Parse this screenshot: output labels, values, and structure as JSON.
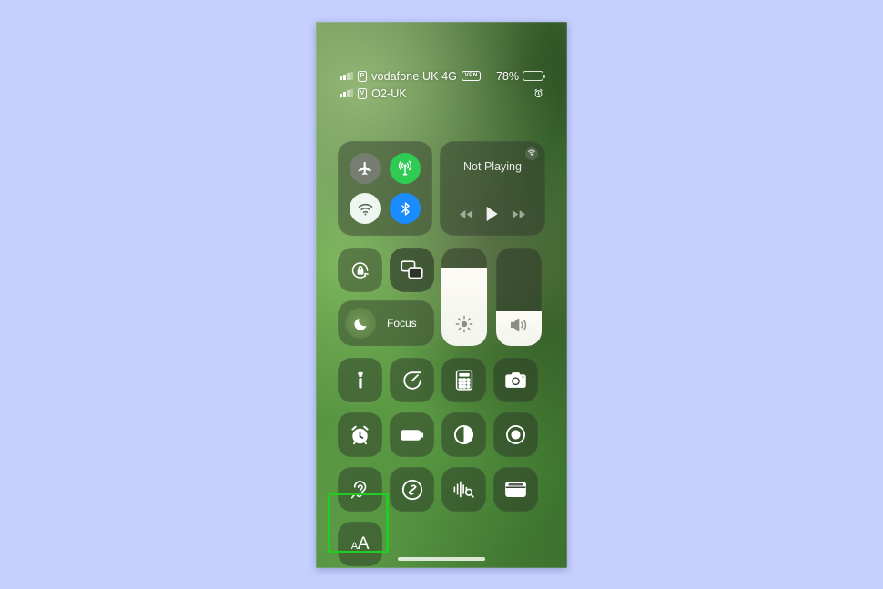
{
  "device": {
    "platform": "iOS",
    "screen_name": "Control Center"
  },
  "status_bar": {
    "line1": {
      "carrier": "vodafone UK 4G",
      "sim_badge": "P",
      "vpn_badge": "VPN",
      "battery_percent": "78%",
      "battery_level": 78
    },
    "line2": {
      "carrier": "O2-UK",
      "sim_badge": "V",
      "alarm_icon": "alarm-clock-icon"
    }
  },
  "connectivity": {
    "airplane": {
      "label": "Airplane Mode",
      "icon": "airplane-icon",
      "state": "off",
      "color": "#7d807c"
    },
    "cellular": {
      "label": "Cellular Data",
      "icon": "cellular-antenna-icon",
      "state": "on",
      "color": "#2fcb52"
    },
    "wifi": {
      "label": "Wi-Fi",
      "icon": "wifi-icon",
      "state": "on",
      "color": "#eef6f0"
    },
    "bluetooth": {
      "label": "Bluetooth",
      "icon": "bluetooth-icon",
      "state": "on",
      "color": "#1a8cff"
    }
  },
  "now_playing": {
    "title": "Not Playing",
    "airplay_icon": "airplay-audio-icon",
    "rewind_icon": "rewind-icon",
    "play_icon": "play-icon",
    "forward_icon": "fast-forward-icon"
  },
  "toggles": {
    "rotation_lock": {
      "label": "Rotation Lock",
      "icon": "rotation-lock-icon"
    },
    "screen_mirroring": {
      "label": "Screen Mirroring",
      "icon": "screen-mirroring-icon"
    },
    "focus": {
      "label": "Focus",
      "icon": "moon-icon"
    }
  },
  "sliders": {
    "brightness": {
      "label": "Brightness",
      "icon": "brightness-sun-icon",
      "value": 80
    },
    "volume": {
      "label": "Volume",
      "icon": "speaker-volume-icon",
      "value": 35
    }
  },
  "tiles": [
    {
      "name": "flashlight",
      "label": "Flashlight",
      "icon": "flashlight-icon"
    },
    {
      "name": "timer",
      "label": "Timer",
      "icon": "timer-icon"
    },
    {
      "name": "calculator",
      "label": "Calculator",
      "icon": "calculator-icon"
    },
    {
      "name": "camera",
      "label": "Camera",
      "icon": "camera-icon"
    },
    {
      "name": "alarm",
      "label": "Alarm",
      "icon": "alarm-clock-icon"
    },
    {
      "name": "low-power-mode",
      "label": "Low Power Mode",
      "icon": "battery-icon"
    },
    {
      "name": "dark-mode",
      "label": "Dark Mode",
      "icon": "dark-mode-icon"
    },
    {
      "name": "screen-recording",
      "label": "Screen Recording",
      "icon": "record-icon"
    },
    {
      "name": "hearing",
      "label": "Hearing",
      "icon": "ear-icon"
    },
    {
      "name": "music-recognition",
      "label": "Music Recognition",
      "icon": "shazam-icon"
    },
    {
      "name": "sound-recognition",
      "label": "Sound Recognition",
      "icon": "sound-recognition-icon"
    },
    {
      "name": "wallet",
      "label": "Wallet",
      "icon": "wallet-icon"
    }
  ],
  "text_size_tile": {
    "label": "Text Size",
    "glyph_small": "A",
    "glyph_large": "A",
    "highlighted": true,
    "highlight_color": "#22cc22"
  },
  "home_indicator": {
    "label": "Home Indicator"
  }
}
